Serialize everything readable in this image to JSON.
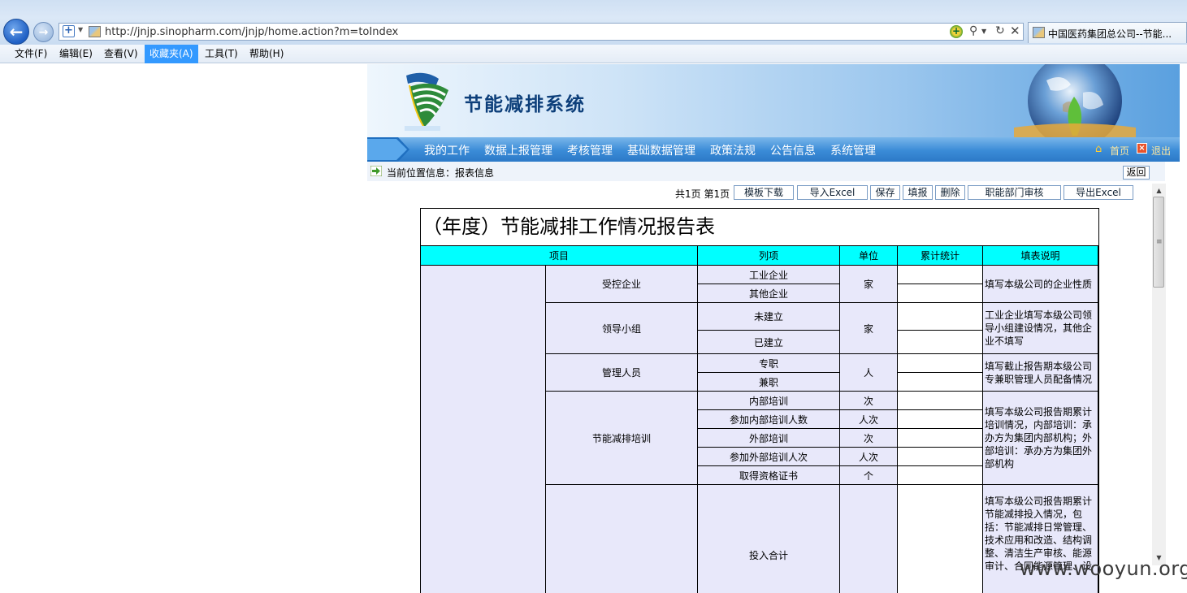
{
  "browser": {
    "url": "http://jnjp.sinopharm.com/jnjp/home.action?m=toIndex",
    "tab_title": "中国医药集团总公司--节能...",
    "menu": [
      "文件(F)",
      "编辑(E)",
      "查看(V)",
      "收藏夹(A)",
      "工具(T)",
      "帮助(H)"
    ],
    "active_menu": "收藏夹(A)"
  },
  "site": {
    "title": "节能减排系统",
    "nav": [
      "我的工作",
      "数据上报管理",
      "考核管理",
      "基础数据管理",
      "政策法规",
      "公告信息",
      "系统管理"
    ],
    "home_label": "首页",
    "logout_label": "退出",
    "location": "当前位置信息：报表信息",
    "return_label": "返回"
  },
  "toolbar": {
    "page_info": "共1页 第1页",
    "buttons": [
      "模板下载",
      "导入Excel",
      "保存",
      "填报",
      "删除",
      "职能部门审核",
      "导出Excel"
    ]
  },
  "report": {
    "title": "（年度）节能减排工作情况报告表",
    "headers": [
      "项目",
      "列项",
      "单位",
      "累计统计",
      "填表说明"
    ],
    "groups": [
      {
        "name": "受控企业",
        "unit": "家",
        "items": [
          "工业企业",
          "其他企业"
        ],
        "note": "填写本级公司的企业性质"
      },
      {
        "name": "领导小组",
        "unit": "家",
        "items": [
          "未建立",
          "已建立"
        ],
        "note": "工业企业填写本级公司领导小组建设情况，其他企业不填写"
      },
      {
        "name": "管理人员",
        "unit": "人",
        "items": [
          "专职",
          "兼职"
        ],
        "note": "填写截止报告期本级公司专兼职管理人员配备情况"
      },
      {
        "name": "节能减排培训",
        "items": [
          "内部培训",
          "参加内部培训人数",
          "外部培训",
          "参加外部培训人次",
          "取得资格证书"
        ],
        "units": [
          "次",
          "人次",
          "次",
          "人次",
          "个"
        ],
        "note": "填写本级公司报告期累计培训情况，内部培训：承办方为集团内部机构；外部培训：承办方为集团外部机构"
      },
      {
        "name": "",
        "items": [
          "投入合计"
        ],
        "note": "填写本级公司报告期累计节能减排投入情况，包括：节能减排日常管理、技术应用和改造、结构调整、清洁生产审核、能源审计、合同能源管理、设"
      }
    ]
  },
  "watermark": "www.wooyun.org"
}
